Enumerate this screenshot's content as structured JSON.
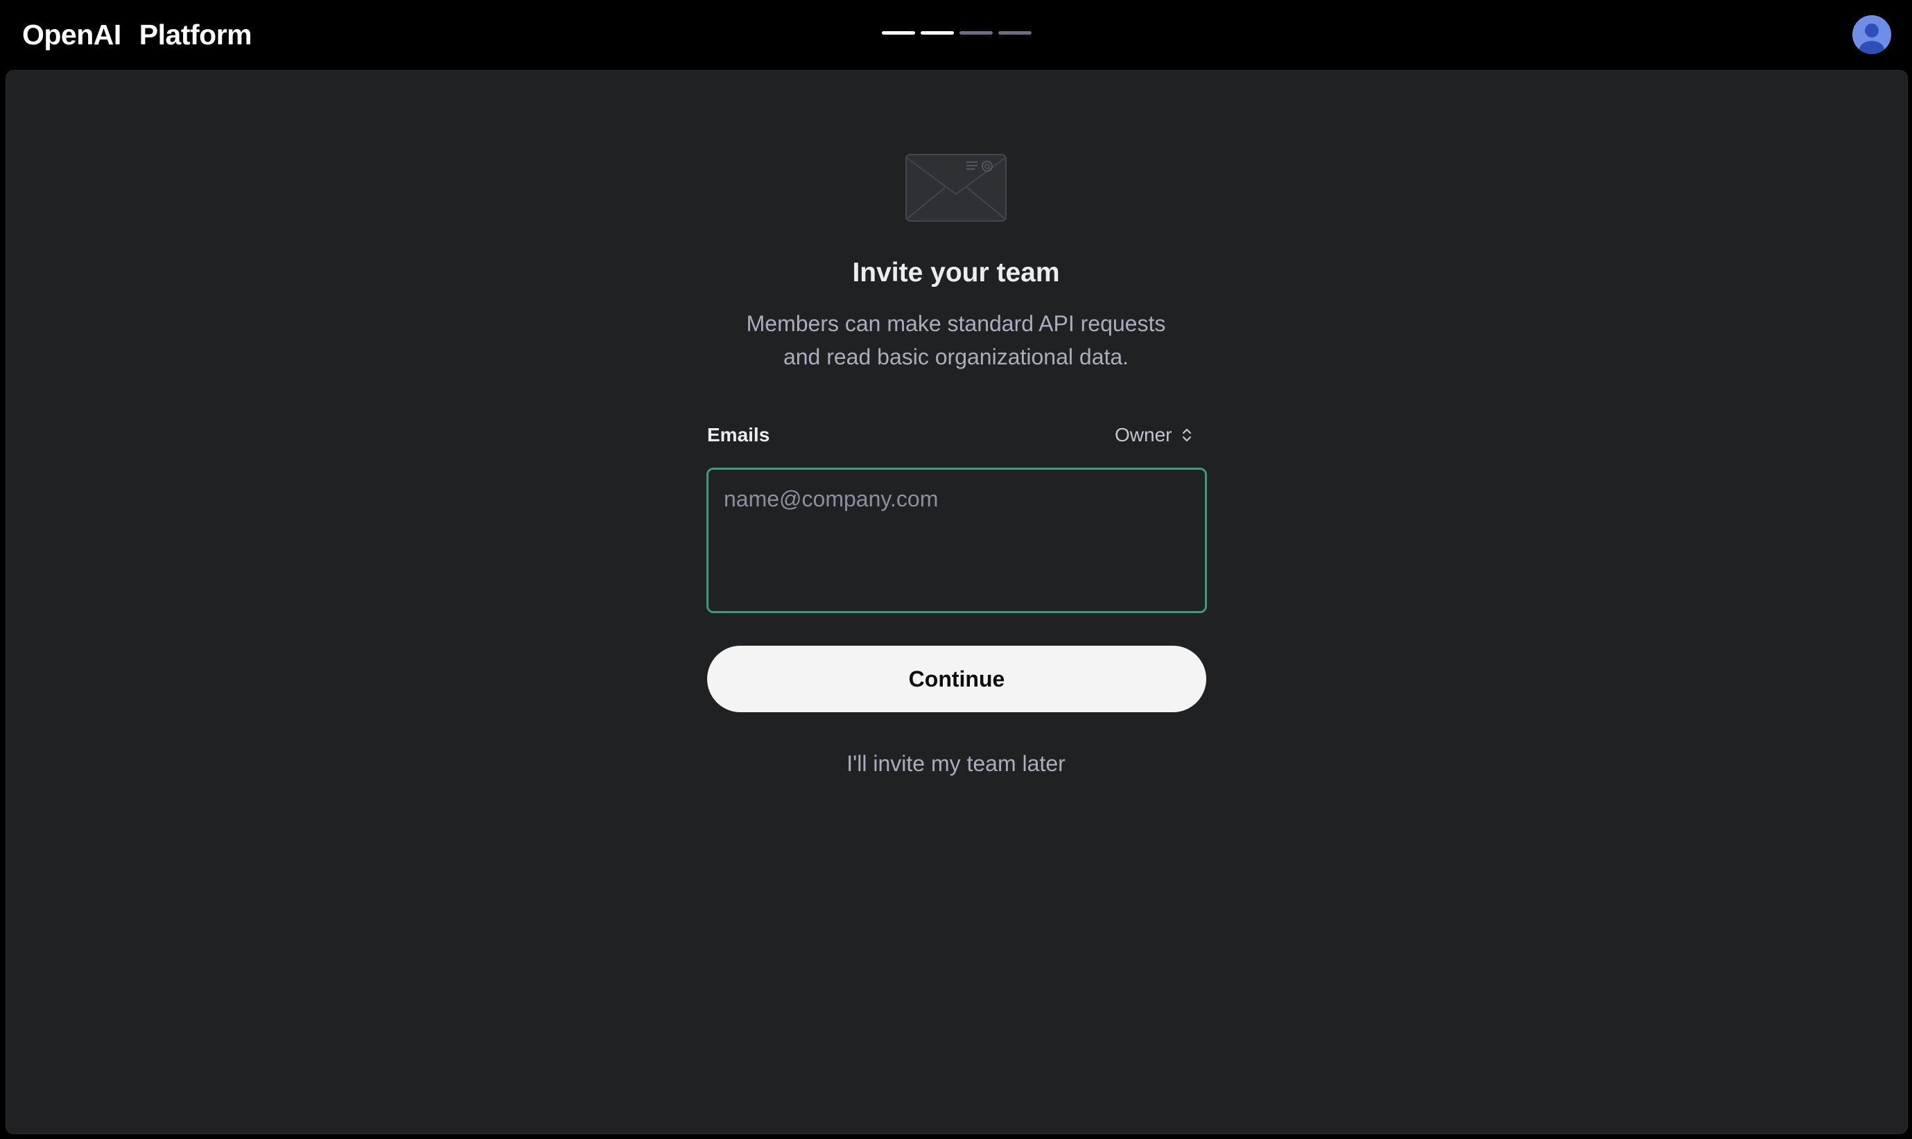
{
  "header": {
    "brand_name": "OpenAI",
    "product_name": "Platform",
    "progress": {
      "total_steps": 4,
      "completed_steps": 2,
      "active_color": "#ffffff",
      "inactive_color": "#6e6e80"
    },
    "avatar_icon": "user-avatar-icon"
  },
  "main": {
    "illustration_icon": "envelope-icon",
    "title": "Invite your team",
    "description_line1": "Members can make standard API requests",
    "description_line2": "and read basic organizational data.",
    "emails_label": "Emails",
    "role_selected": "Owner",
    "role_icon": "up-down-chevron-icon",
    "email_placeholder": "name@company.com",
    "email_value": "",
    "continue_label": "Continue",
    "skip_label": "I'll invite my team later"
  },
  "colors": {
    "background": "#000000",
    "panel": "#202123",
    "input_focus_border": "#3d9a7f",
    "button_bg": "#f4f4f4"
  }
}
